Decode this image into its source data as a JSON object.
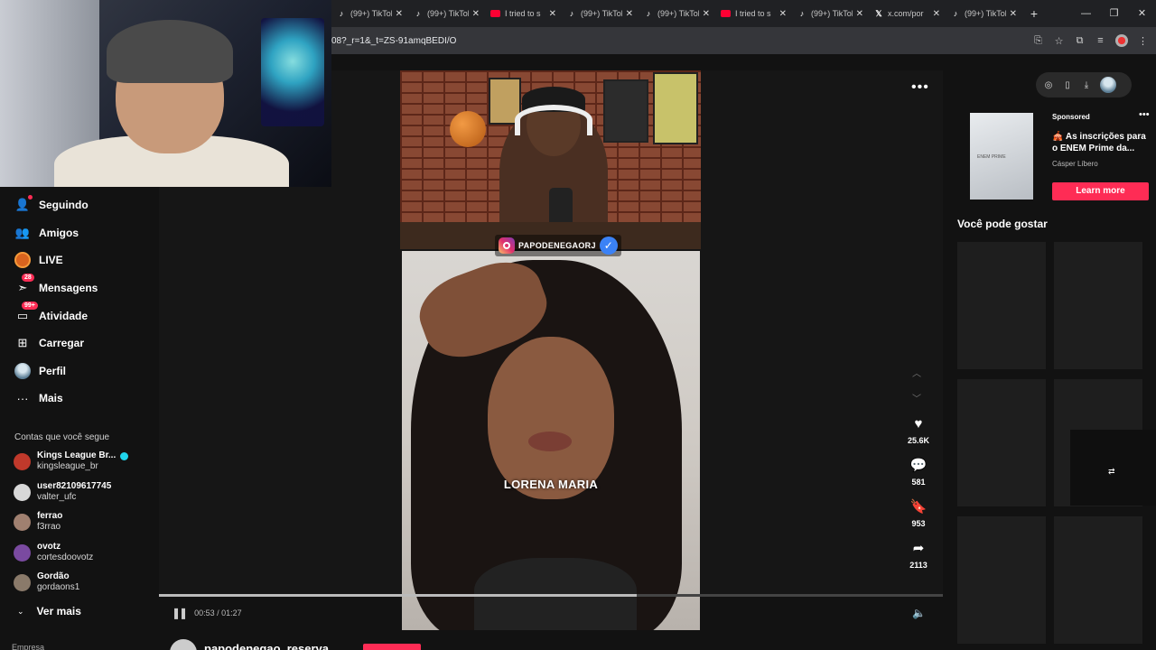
{
  "browser": {
    "tabs": [
      {
        "icon": "tiktok-icon",
        "kind": "tt",
        "title": "(99+) TikTok"
      },
      {
        "icon": "tiktok-icon",
        "kind": "tt",
        "title": "(99+) TikTok"
      },
      {
        "icon": "youtube-icon",
        "kind": "yt",
        "title": "I tried to s"
      },
      {
        "icon": "tiktok-icon",
        "kind": "tt",
        "title": "(99+) TikTok"
      },
      {
        "icon": "tiktok-icon",
        "kind": "tt",
        "title": "(99+) TikTok"
      },
      {
        "icon": "youtube-icon",
        "kind": "yt",
        "title": "I tried to s"
      },
      {
        "icon": "tiktok-icon",
        "kind": "tt",
        "title": "(99+) TikTok"
      },
      {
        "icon": "x-icon",
        "kind": "x",
        "title": "x.com/por"
      },
      {
        "icon": "tiktok-icon",
        "kind": "tt",
        "title": "(99+) TikTok"
      }
    ],
    "url": "08?_r=1&_t=ZS-91amqBEDI/O"
  },
  "sidebar": {
    "items": [
      {
        "name": "seguindo",
        "icon": "user-follow-icon",
        "label": "Seguindo",
        "badge": ""
      },
      {
        "name": "amigos",
        "icon": "friends-icon",
        "label": "Amigos",
        "badge": ""
      },
      {
        "name": "live",
        "icon": "live-icon",
        "label": "LIVE",
        "badge": ""
      },
      {
        "name": "mensagens",
        "icon": "message-icon",
        "label": "Mensagens",
        "badge": "28"
      },
      {
        "name": "atividade",
        "icon": "activity-icon",
        "label": "Atividade",
        "badge": "99+"
      },
      {
        "name": "carregar",
        "icon": "upload-icon",
        "label": "Carregar",
        "badge": ""
      },
      {
        "name": "perfil",
        "icon": "profile-icon",
        "label": "Perfil",
        "badge": ""
      },
      {
        "name": "mais",
        "icon": "more-icon",
        "label": "Mais",
        "badge": ""
      }
    ],
    "following_title": "Contas que você segue",
    "following": [
      {
        "name": "Kings League Br...",
        "handle": "kingsleague_br",
        "verified": true,
        "color": "#c0392b"
      },
      {
        "name": "user82109617745",
        "handle": "valter_ufc",
        "verified": false,
        "color": "#d8d8d8"
      },
      {
        "name": "ferrao",
        "handle": "f3rrao",
        "verified": false,
        "color": "#a08070"
      },
      {
        "name": "ovotz",
        "handle": "cortesdoovotz",
        "verified": false,
        "color": "#7a4aa0"
      },
      {
        "name": "Gordão",
        "handle": "gordaons1",
        "verified": false,
        "color": "#8a7a6a"
      }
    ],
    "see_more": "Ver mais",
    "companies": "Empresa"
  },
  "video": {
    "instagram_handle": "PAPODENEGAORJ",
    "caption": "LORENA MARIA",
    "likes": "25.6K",
    "comments": "581",
    "saves": "953",
    "shares": "2113",
    "time": "00:53 / 01:27",
    "progress": 0.61,
    "author": "papodenegao_reserva"
  },
  "ad": {
    "thumb_text": "ENEM PRIME",
    "sponsored": "Sponsored",
    "title": "🎪 As inscrições para o ENEM Prime da...",
    "advertiser": "Cásper Líbero",
    "cta": "Learn more"
  },
  "right": {
    "might_like": "Você pode gostar"
  }
}
